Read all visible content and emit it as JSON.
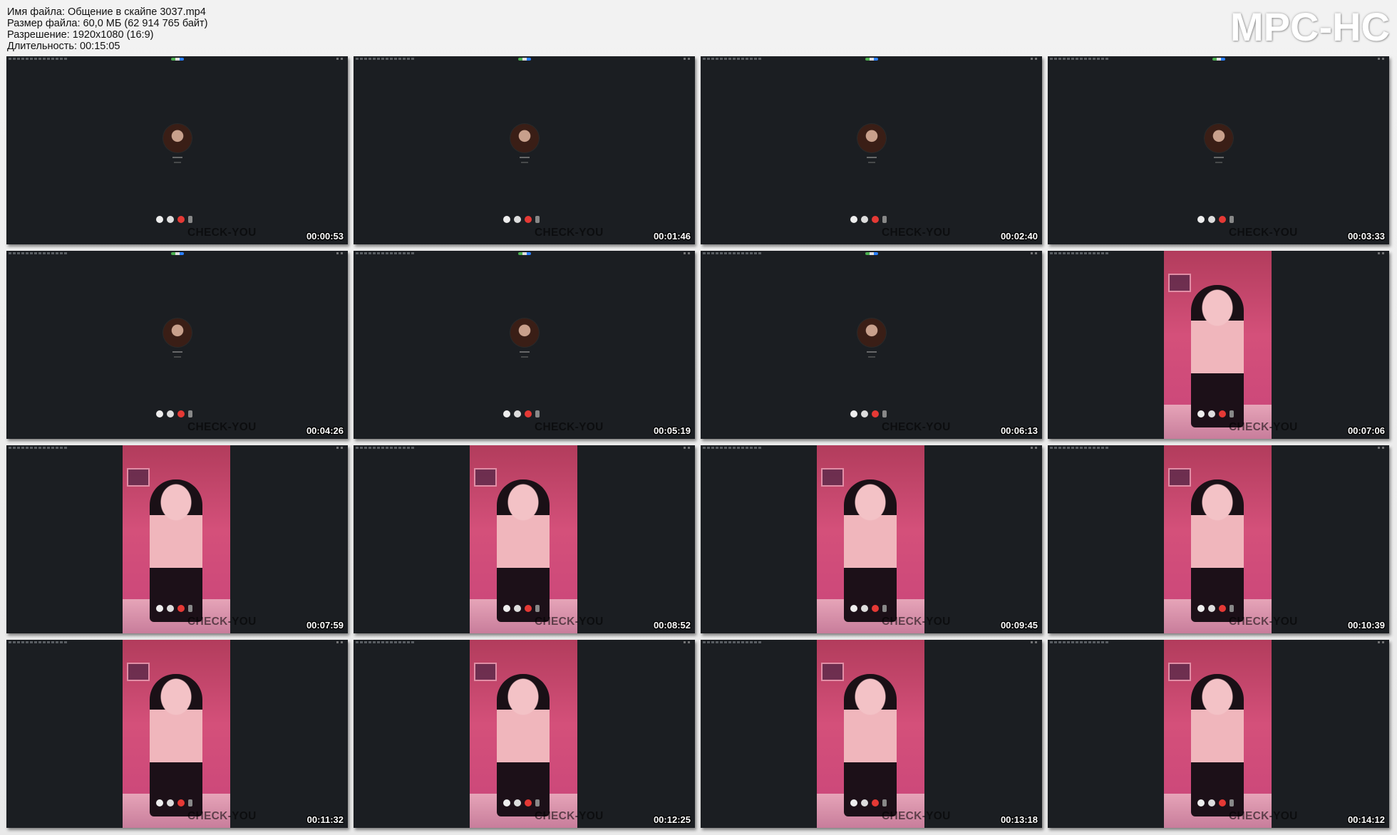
{
  "header": {
    "file_name": "Имя файла: Общение в скайпе 3037.mp4",
    "file_size": "Размер файла: 60,0 МБ (62 914 765 байт)",
    "resolution": "Разрешение: 1920x1080 (16:9)",
    "duration": "Длительность: 00:15:05"
  },
  "logo": "MPC-HC",
  "thumbnails": [
    {
      "time": "00:00:53",
      "watermark": "CHECK-YOU",
      "scene": "avatar"
    },
    {
      "time": "00:01:46",
      "watermark": "CHECK-YOU",
      "scene": "avatar"
    },
    {
      "time": "00:02:40",
      "watermark": "CHECK-YOU",
      "scene": "avatar"
    },
    {
      "time": "00:03:33",
      "watermark": "CHECK-YOU",
      "scene": "avatar"
    },
    {
      "time": "00:04:26",
      "watermark": "CHECK-YOU",
      "scene": "avatar"
    },
    {
      "time": "00:05:19",
      "watermark": "CHECK-YOU",
      "scene": "avatar"
    },
    {
      "time": "00:06:13",
      "watermark": "CHECK-YOU",
      "scene": "avatar"
    },
    {
      "time": "00:07:06",
      "watermark": "CHECK-YOU",
      "scene": "video"
    },
    {
      "time": "00:07:59",
      "watermark": "CHECK-YOU",
      "scene": "video"
    },
    {
      "time": "00:08:52",
      "watermark": "CHECK-YOU",
      "scene": "video"
    },
    {
      "time": "00:09:45",
      "watermark": "CHECK-YOU",
      "scene": "video"
    },
    {
      "time": "00:10:39",
      "watermark": "CHECK-YOU",
      "scene": "video"
    },
    {
      "time": "00:11:32",
      "watermark": "CHECK-YOU",
      "scene": "video"
    },
    {
      "time": "00:12:25",
      "watermark": "CHECK-YOU",
      "scene": "video"
    },
    {
      "time": "00:13:18",
      "watermark": "CHECK-YOU",
      "scene": "video"
    },
    {
      "time": "00:14:12",
      "watermark": "CHECK-YOU",
      "scene": "video"
    }
  ]
}
